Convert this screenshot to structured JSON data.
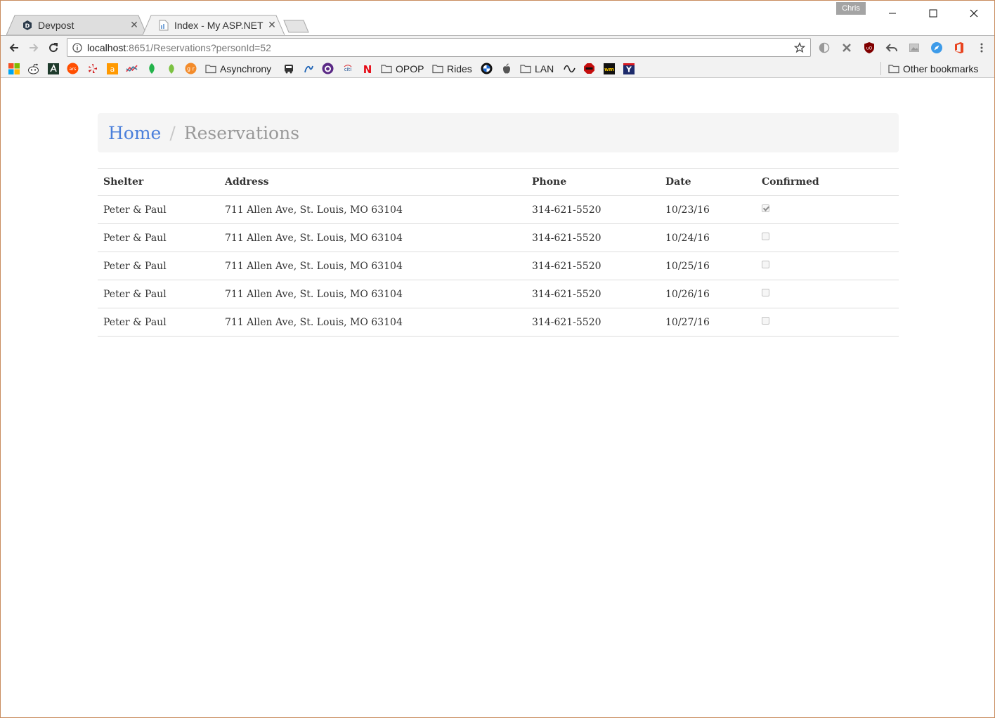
{
  "browser": {
    "profile_name": "Chris",
    "tabs": [
      {
        "title": "Devpost",
        "favicon": "devpost-icon",
        "active": false
      },
      {
        "title": "Index - My ASP.NET",
        "favicon": "page-icon",
        "active": true
      }
    ],
    "url_host": "localhost",
    "url_path": ":8651/Reservations?personId=52",
    "bookmark_folders": {
      "asynchrony": "Asynchrony",
      "opop": "OPOP",
      "rides": "Rides",
      "lan": "LAN",
      "other": "Other bookmarks"
    },
    "bookmark_icon_text": {
      "amazon": "a",
      "ars": "ars",
      "gr": "g r",
      "citi": "citi",
      "netflix": "N",
      "wm": "wm",
      "ym": "Y"
    }
  },
  "breadcrumb": {
    "home": "Home",
    "separator": "/",
    "current": "Reservations"
  },
  "table": {
    "columns": [
      "Shelter",
      "Address",
      "Phone",
      "Date",
      "Confirmed"
    ],
    "rows": [
      {
        "shelter": "Peter & Paul",
        "address": "711 Allen Ave, St. Louis, MO 63104",
        "phone": "314-621-5520",
        "date": "10/23/16",
        "confirmed": true
      },
      {
        "shelter": "Peter & Paul",
        "address": "711 Allen Ave, St. Louis, MO 63104",
        "phone": "314-621-5520",
        "date": "10/24/16",
        "confirmed": false
      },
      {
        "shelter": "Peter & Paul",
        "address": "711 Allen Ave, St. Louis, MO 63104",
        "phone": "314-621-5520",
        "date": "10/25/16",
        "confirmed": false
      },
      {
        "shelter": "Peter & Paul",
        "address": "711 Allen Ave, St. Louis, MO 63104",
        "phone": "314-621-5520",
        "date": "10/26/16",
        "confirmed": false
      },
      {
        "shelter": "Peter & Paul",
        "address": "711 Allen Ave, St. Louis, MO 63104",
        "phone": "314-621-5520",
        "date": "10/27/16",
        "confirmed": false
      }
    ]
  },
  "colors": {
    "link": "#4a7fdb",
    "breadcrumb_bg": "#f5f5f5",
    "window_border": "#c98b5e"
  }
}
